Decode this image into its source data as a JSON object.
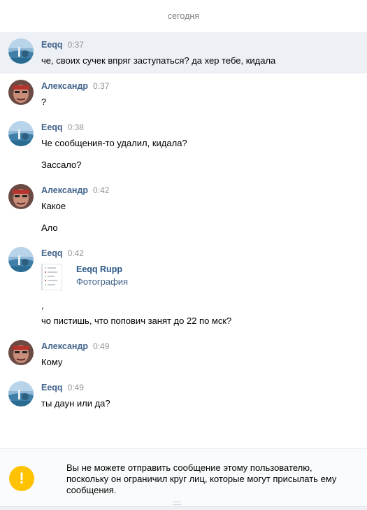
{
  "date_separator": "сегодня",
  "messages": [
    {
      "author": "Eeqq",
      "time": "0:37",
      "texts": [
        "че, своих сучек впряг заступаться? да хер тебе, кидала"
      ]
    },
    {
      "author": "Александр",
      "time": "0:37",
      "texts": [
        "?"
      ]
    },
    {
      "author": "Eeqq",
      "time": "0:38",
      "texts": [
        "Че сообщения-то удалил, кидала?",
        "Зассало?"
      ]
    },
    {
      "author": "Александр",
      "time": "0:42",
      "texts": [
        "Какое",
        "Ало"
      ]
    },
    {
      "author": "Eeqq",
      "time": "0:42",
      "attachment": {
        "title": "Eeqq Rupp",
        "subtitle": "Фотография"
      },
      "comma": ",",
      "texts": [
        "чо пистишь, что попович занят до 22 по мск?"
      ]
    },
    {
      "author": "Александр",
      "time": "0:49",
      "texts": [
        "Кому"
      ]
    },
    {
      "author": "Eeqq",
      "time": "0:49",
      "texts": [
        "ты даун или да?"
      ]
    }
  ],
  "footer": {
    "icon": "exclamation-icon",
    "icon_glyph": "!",
    "notice": "Вы не можете отправить сообщение этому пользователю, поскольку он ограничил круг лиц, которые могут присылать ему сообщения."
  },
  "colors": {
    "author": "#42648b",
    "highlight": "#edf0f5",
    "warning": "#ffc200",
    "link": "#2a5885"
  }
}
